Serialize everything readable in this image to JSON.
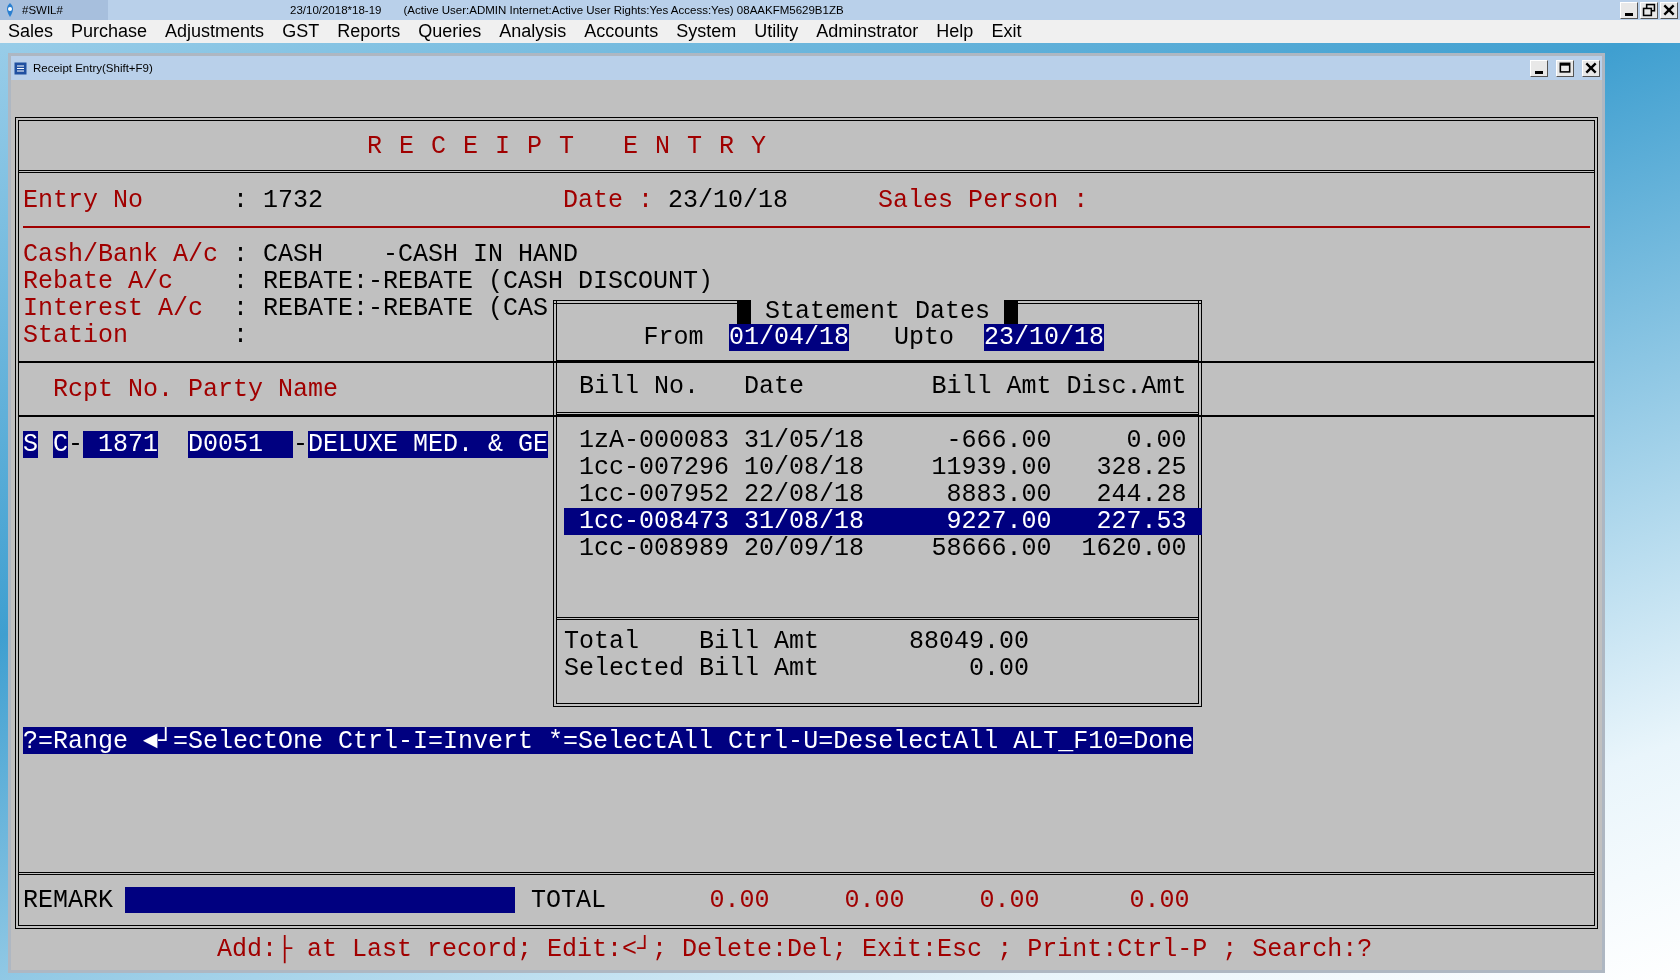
{
  "app": {
    "title": "#SWIL#",
    "session": "23/10/2018*18-19",
    "status": "(Active User:ADMIN Internet:Active  User Rights:Yes Access:Yes) 08AAKFM5629B1ZB"
  },
  "menu": [
    "Sales",
    "Purchase",
    "Adjustments",
    "GST",
    "Reports",
    "Queries",
    "Analysis",
    "Accounts",
    "System",
    "Utility",
    "Adminstrator",
    "Help",
    "Exit"
  ],
  "window": {
    "title": "Receipt Entry(Shift+F9)"
  },
  "heading": "R E C E I P T   E N T R Y",
  "entry": {
    "label": "Entry No",
    "colon": ":",
    "value": "1732",
    "date_label": "Date :",
    "date": "23/10/18",
    "sales_person_label": "Sales Person :"
  },
  "accounts": [
    {
      "label": "Cash/Bank A/c",
      "colon": ":",
      "value": "CASH    -CASH IN HAND"
    },
    {
      "label": "Rebate A/c",
      "colon": ":",
      "value": "REBATE:-REBATE (CASH DISCOUNT)"
    },
    {
      "label": "Interest A/c",
      "colon": ":",
      "value": "REBATE:-REBATE (CAS"
    },
    {
      "label": "Station",
      "colon": ":"
    }
  ],
  "columns": [
    "Rcpt No.",
    "Party Name"
  ],
  "receipt_row": {
    "cells": [
      "S",
      "C",
      "1871",
      "D0051",
      "DELUXE MED. & GE"
    ],
    "separators": [
      "-",
      "-"
    ]
  },
  "statement": {
    "title": "Statement Dates",
    "from_label": "From",
    "from": "01/04/18",
    "upto_label": "Upto",
    "upto": "23/10/18",
    "columns": [
      "Bill No.",
      "Date",
      "Bill Amt",
      "Disc.Amt"
    ],
    "rows": [
      {
        "bill_no": "1zA-000083",
        "date": "31/05/18",
        "bill_amt": "-666.00",
        "disc_amt": "0.00",
        "selected": false
      },
      {
        "bill_no": "1cc-007296",
        "date": "10/08/18",
        "bill_amt": "11939.00",
        "disc_amt": "328.25",
        "selected": false
      },
      {
        "bill_no": "1cc-007952",
        "date": "22/08/18",
        "bill_amt": "8883.00",
        "disc_amt": "244.28",
        "selected": false
      },
      {
        "bill_no": "1cc-008473",
        "date": "31/08/18",
        "bill_amt": "9227.00",
        "disc_amt": "227.53",
        "selected": true
      },
      {
        "bill_no": "1cc-008989",
        "date": "20/09/18",
        "bill_amt": "58666.00",
        "disc_amt": "1620.00",
        "selected": false
      }
    ],
    "totals": [
      {
        "label": "Total",
        "label2": "Bill Amt",
        "value": "88049.00"
      },
      {
        "label": "Selected",
        "label2": "Bill Amt",
        "value": "0.00"
      }
    ]
  },
  "help_bar": "?=Range ◄┘=SelectOne Ctrl-I=Invert *=SelectAll Ctrl-U=DeselectAll ALT_F10=Done",
  "footer": {
    "remark_label": "REMARK",
    "total_label": "TOTAL",
    "totals": [
      "0.00",
      "0.00",
      "0.00",
      "0.00"
    ]
  },
  "status_line": "Add:├ at Last record; Edit:<┘; Delete:Del; Exit:Esc ; Print:Ctrl-P ; Search:?"
}
